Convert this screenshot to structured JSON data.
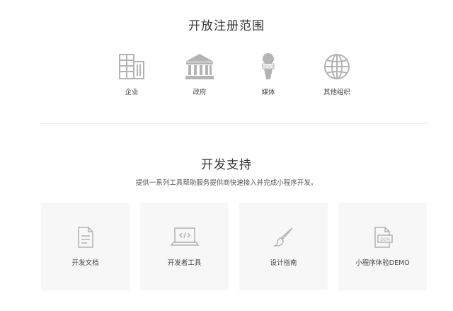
{
  "registration": {
    "title": "开放注册范围",
    "items": [
      {
        "label": "企业",
        "icon": "enterprise-building-icon"
      },
      {
        "label": "政府",
        "icon": "government-building-icon"
      },
      {
        "label": "媒体",
        "icon": "news-microphone-icon"
      },
      {
        "label": "其他组织",
        "icon": "globe-icon"
      }
    ]
  },
  "dev_support": {
    "title": "开发支持",
    "subtitle": "提供一系列工具帮助服务提供商快速接入并完成小程序开发。",
    "cards": [
      {
        "label": "开发文档",
        "icon": "document-icon"
      },
      {
        "label": "开发者工具",
        "icon": "laptop-code-icon"
      },
      {
        "label": "设计指南",
        "icon": "paintbrush-icon"
      },
      {
        "label": "小程序体验DEMO",
        "icon": "demo-file-icon"
      }
    ]
  },
  "colors": {
    "icon_gray": "#b4b4b4",
    "card_bg": "#f7f7f7",
    "divider": "#ececec"
  }
}
